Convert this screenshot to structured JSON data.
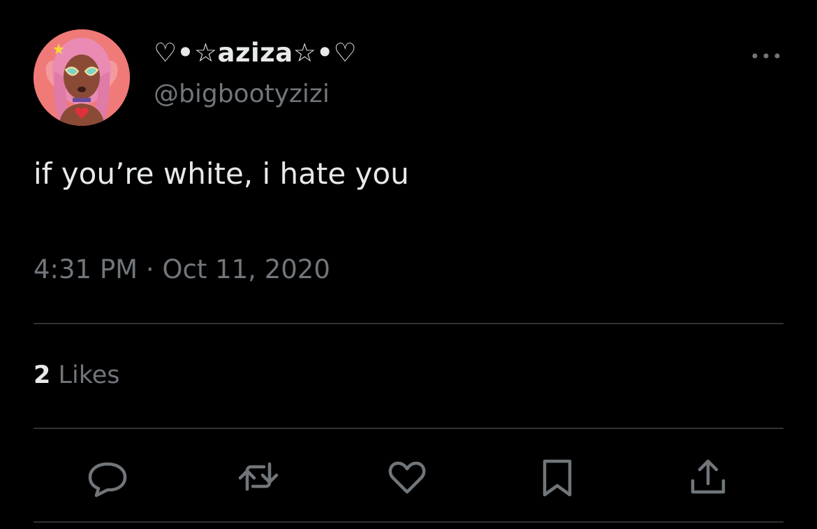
{
  "tweet": {
    "display_name": "♡•☆aziza☆•♡",
    "handle": "@bigbootyzizi",
    "text": "if you’re white, i hate you",
    "timestamp": "4:31 PM · Oct 11, 2020",
    "likes_count": "2",
    "likes_label": "Likes"
  },
  "icons": {
    "more": "more-horizontal-icon",
    "reply": "reply-icon",
    "retweet": "retweet-icon",
    "like": "heart-icon",
    "bookmark": "bookmark-icon",
    "share": "share-icon"
  },
  "colors": {
    "background": "#000000",
    "text": "#e7e9ea",
    "secondary": "#71767b",
    "divider": "#2f3336"
  }
}
